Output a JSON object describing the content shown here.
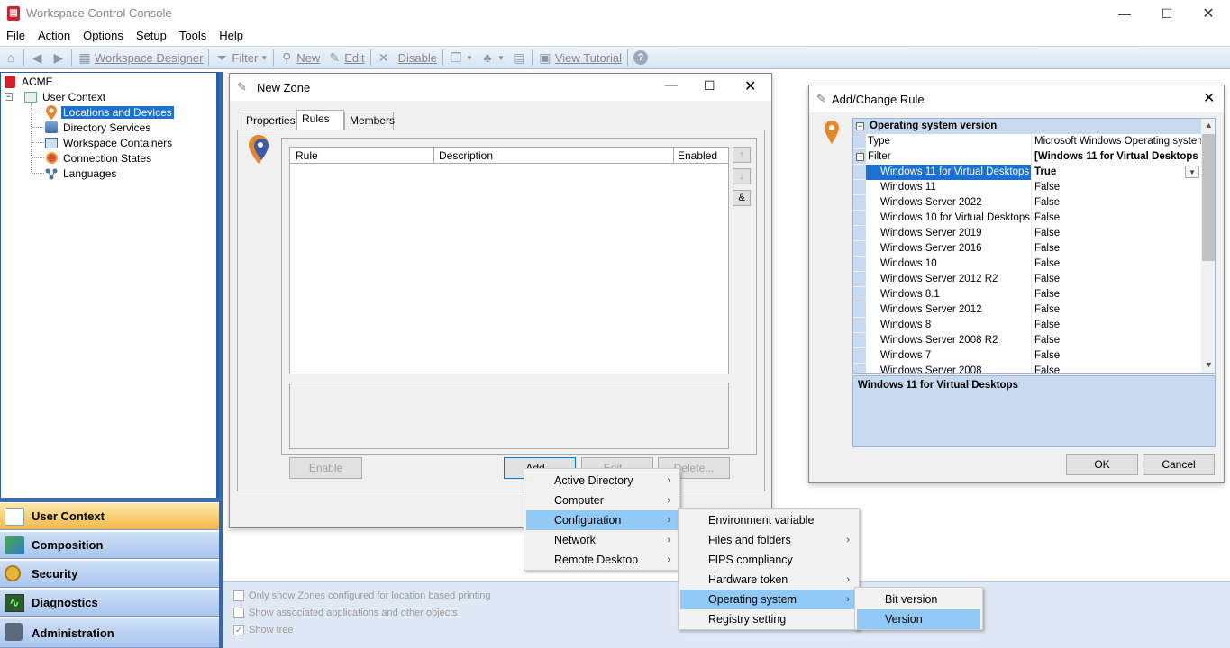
{
  "app": {
    "title": "Workspace Control Console"
  },
  "menu": [
    "File",
    "Action",
    "Options",
    "Setup",
    "Tools",
    "Help"
  ],
  "toolbar": {
    "workspace_designer": "Workspace Designer",
    "filter": "Filter",
    "new": "New",
    "edit": "Edit",
    "disable": "Disable",
    "view_tutorial": "View Tutorial"
  },
  "tree": {
    "root": "ACME",
    "user_context": "User Context",
    "children": [
      "Locations and Devices",
      "Directory Services",
      "Workspace Containers",
      "Connection States",
      "Languages"
    ]
  },
  "nav": [
    "User Context",
    "Composition",
    "Security",
    "Diagnostics",
    "Administration"
  ],
  "bottom_options": [
    "Only show Zones configured for location based printing",
    "Show associated applications and other objects",
    "Show tree"
  ],
  "new_zone": {
    "title": "New Zone",
    "tabs": [
      "Properties",
      "Rules",
      "Members"
    ],
    "columns": [
      "Rule",
      "Description",
      "Enabled"
    ],
    "side_buttons": [
      "↑",
      "↓",
      "&"
    ],
    "enable_btn": "Enable",
    "add_btn": "Add...",
    "edit_btn": "Edit...",
    "delete_btn": "Delete..."
  },
  "context_menu_1": [
    "Active Directory",
    "Computer",
    "Configuration",
    "Network",
    "Remote Desktop"
  ],
  "context_menu_2": [
    "Environment variable",
    "Files and folders",
    "FIPS compliancy",
    "Hardware token",
    "Operating system",
    "Registry setting"
  ],
  "context_menu_3": [
    "Bit version",
    "Version"
  ],
  "add_rule": {
    "title": "Add/Change Rule",
    "category": "Operating system version",
    "type_label": "Type",
    "type_value": "Microsoft Windows Operating system",
    "filter_label": "Filter",
    "filter_value": "[Windows 11 for Virtual Desktops",
    "rows": [
      {
        "name": "Windows 11 for Virtual Desktops",
        "value": "True"
      },
      {
        "name": "Windows 11",
        "value": "False"
      },
      {
        "name": "Windows Server 2022",
        "value": "False"
      },
      {
        "name": "Windows 10 for Virtual Desktops",
        "value": "False"
      },
      {
        "name": "Windows Server 2019",
        "value": "False"
      },
      {
        "name": "Windows Server 2016",
        "value": "False"
      },
      {
        "name": "Windows 10",
        "value": "False"
      },
      {
        "name": "Windows Server 2012 R2",
        "value": "False"
      },
      {
        "name": "Windows 8.1",
        "value": "False"
      },
      {
        "name": "Windows Server 2012",
        "value": "False"
      },
      {
        "name": "Windows 8",
        "value": "False"
      },
      {
        "name": "Windows Server 2008 R2",
        "value": "False"
      },
      {
        "name": "Windows 7",
        "value": "False"
      },
      {
        "name": "Windows Server 2008",
        "value": "False"
      }
    ],
    "description": "Windows 11 for Virtual Desktops",
    "ok": "OK",
    "cancel": "Cancel"
  },
  "colors": {
    "accent": "#1d6fd0",
    "highlight": "#91c9f7",
    "nav_active": "#f5b94a",
    "brand": "#d0202a"
  }
}
